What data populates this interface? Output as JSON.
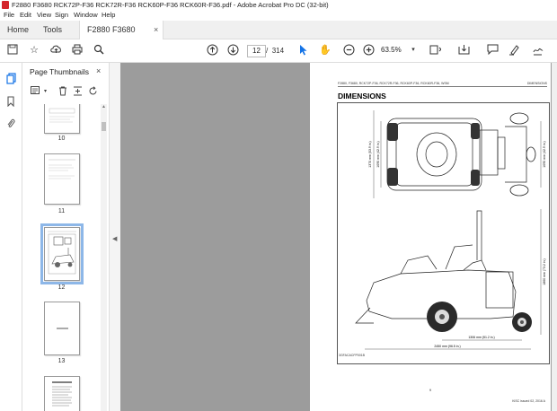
{
  "window": {
    "title": "F2880 F3680 RCK72P-F36 RCK72R-F36 RCK60P-F36 RCK60R-F36.pdf - Adobe Acrobat Pro DC (32-bit)"
  },
  "menu": {
    "items": [
      "File",
      "Edit",
      "View",
      "Sign",
      "Window",
      "Help"
    ]
  },
  "tabs": {
    "home": "Home",
    "tools": "Tools",
    "document": "F2880 F3680 RCK7...",
    "close": "×"
  },
  "toolbar": {
    "page_current": "12",
    "page_separator": "/",
    "page_total": "314",
    "zoom": "63.5%"
  },
  "thumbnails_panel": {
    "title": "Page Thumbnails",
    "close": "×",
    "pages": [
      {
        "label": "10"
      },
      {
        "label": "11"
      },
      {
        "label": "12",
        "selected": true
      },
      {
        "label": "13"
      },
      {
        "label": ""
      }
    ]
  },
  "page": {
    "header_left": "F2880, F3680, RCK72P-F36, RCK72R-F36, RCK60P-F36, RCK60R-F36, WSM",
    "header_right": "DIMENSIONS",
    "title": "DIMENSIONS",
    "figure_code": "3GFACACFP001B",
    "page_number": "9",
    "footer": "KiSC issued 02, 2016 A",
    "dims": {
      "width_outer": "1370 mm (53.9 in.)",
      "width_inner": "1090 mm (42.9 in.)",
      "width_right": "1090 mm (42.9 in.)",
      "height": "1860 mm (73.2 in.)",
      "wheelbase": "1306 mm (51.2 in.)",
      "length": "2450 mm (96.5 in.)"
    }
  },
  "colors": {
    "accent": "#1473e6",
    "pdf_icon": "#d4252b",
    "doc_background": "#9c9c9c",
    "selected_thumb": "#8db7e8"
  }
}
